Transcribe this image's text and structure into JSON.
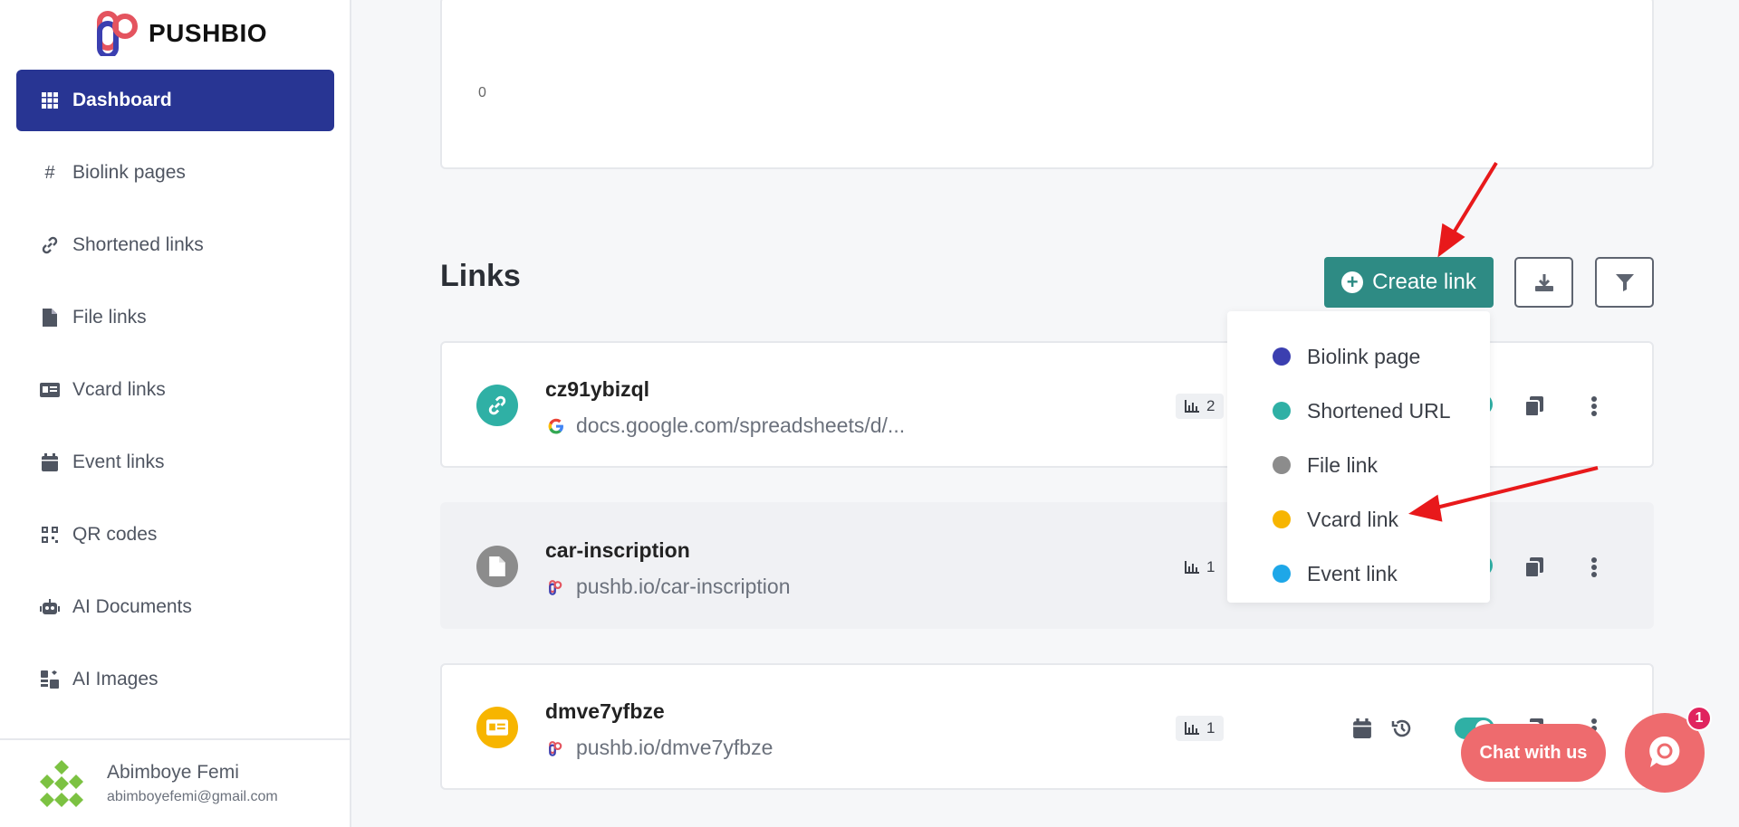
{
  "brand": {
    "name": "PUSHBIO"
  },
  "sidebar": {
    "items": [
      {
        "label": "Dashboard",
        "icon": "grid-icon",
        "active": true
      },
      {
        "label": "Biolink pages",
        "icon": "hash-icon"
      },
      {
        "label": "Shortened links",
        "icon": "link-icon"
      },
      {
        "label": "File links",
        "icon": "file-icon"
      },
      {
        "label": "Vcard links",
        "icon": "id-card-icon"
      },
      {
        "label": "Event links",
        "icon": "calendar-icon"
      },
      {
        "label": "QR codes",
        "icon": "qr-icon"
      },
      {
        "label": "AI Documents",
        "icon": "robot-icon"
      },
      {
        "label": "AI Images",
        "icon": "ai-images-icon"
      }
    ],
    "user": {
      "name": "Abimboye Femi",
      "email": "abimboyefemi@gmail.com"
    }
  },
  "chart": {
    "zero_label": "0"
  },
  "links": {
    "title": "Links",
    "create_label": "Create link",
    "rows": [
      {
        "title": "cz91ybizql",
        "url": "docs.google.com/spreadsheets/d/...",
        "clicks": "2",
        "type_color": "#2fb0a5"
      },
      {
        "title": "car-inscription",
        "url": "pushb.io/car-inscription",
        "clicks": "1",
        "type_color": "#8c8c8c"
      },
      {
        "title": "dmve7yfbze",
        "url": "pushb.io/dmve7yfbze",
        "clicks": "1",
        "type_color": "#f7b500"
      }
    ]
  },
  "dropdown": {
    "items": [
      {
        "label": "Biolink page",
        "color": "#3b3fb0"
      },
      {
        "label": "Shortened URL",
        "color": "#2fb0a5"
      },
      {
        "label": "File link",
        "color": "#8c8c8c"
      },
      {
        "label": "Vcard link",
        "color": "#f7b500"
      },
      {
        "label": "Event link",
        "color": "#1ea7e8"
      }
    ]
  },
  "chat": {
    "label": "Chat with us",
    "badge": "1"
  },
  "colors": {
    "primary": "#283593",
    "accent": "#2e8b84",
    "annotation": "#e8191b",
    "chat": "#ee6b6e"
  }
}
